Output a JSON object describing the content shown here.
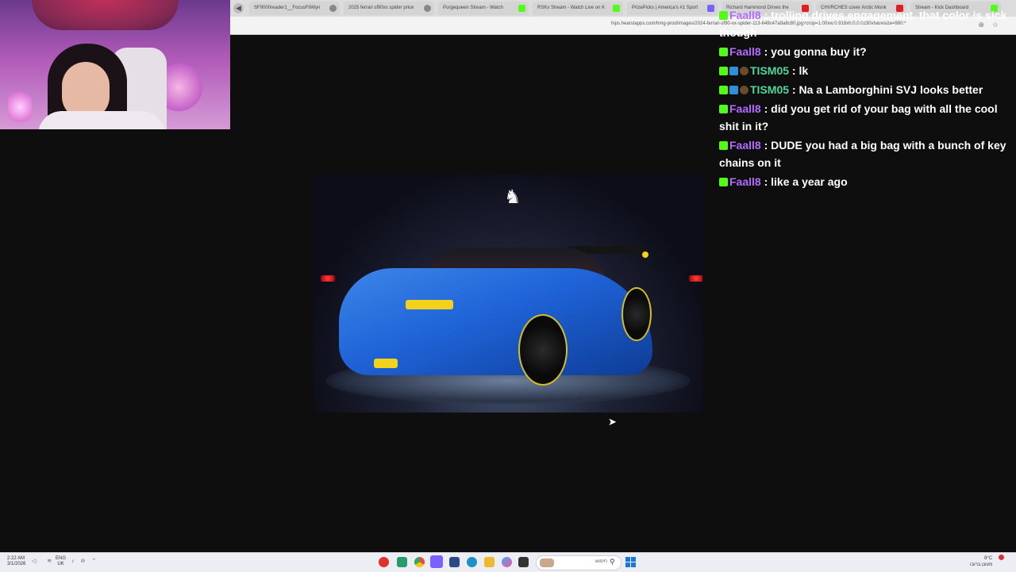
{
  "browser": {
    "tabs": [
      {
        "title": "SF9000reader1__FocusFitWyn",
        "favicon": "other"
      },
      {
        "title": "2025 ferrari sf90xx spider price",
        "favicon": "other"
      },
      {
        "title": "Purgequeen Stream - Watch",
        "favicon": "kick"
      },
      {
        "title": "RSKx Stream - Watch Live on K",
        "favicon": "kick"
      },
      {
        "title": "PrizePicks | America's #1 Sport",
        "favicon": "pp"
      },
      {
        "title": "Richard Hammond Drives the",
        "favicon": "yt"
      },
      {
        "title": "CHVRCHES cover Arctic Monk",
        "favicon": "yt"
      },
      {
        "title": "Stream - Kick Dashboard",
        "favicon": "kick"
      }
    ],
    "url": "hips.hearstapps.com/hmg-prod/images/2024-ferrari-sf90-xx-spider-113-649c47a9a8c80.jpg?crop=1.00xw:0.918xh;0,0.0230xh&resize=980:*"
  },
  "chat": {
    "messages": [
      {
        "user": "Faall8",
        "text": "trolling drives engagement. that color is sick though",
        "color": "#b36bff",
        "badges": [
          "kick-badge"
        ]
      },
      {
        "user": "Faall8",
        "text": "you gonna buy it?",
        "color": "#b36bff",
        "badges": [
          "kick-badge"
        ]
      },
      {
        "user": "TISM05",
        "text": "lk",
        "color": "#4fd69c",
        "badges": [
          "kick-badge",
          "verified-badge",
          "ball-badge"
        ]
      },
      {
        "user": "TISM05",
        "text": "Na a Lamborghini SVJ looks better",
        "color": "#4fd69c",
        "badges": [
          "kick-badge",
          "verified-badge",
          "ball-badge"
        ]
      },
      {
        "user": "Faall8",
        "text": "did you get rid of your bag with all the cool shit in it?",
        "color": "#b36bff",
        "badges": [
          "kick-badge"
        ]
      },
      {
        "user": "Faall8",
        "text": "DUDE you had a big bag with a bunch of key chains on it",
        "color": "#b36bff",
        "badges": [
          "kick-badge"
        ]
      },
      {
        "user": "Faall8",
        "text": "like a year ago",
        "color": "#b36bff",
        "badges": [
          "kick-badge"
        ]
      }
    ]
  },
  "taskbar": {
    "time": "2:22 AM",
    "date": "3/1/2026",
    "lang_top": "ENG",
    "lang_bottom": "UK",
    "search_text": "חיפוש",
    "weather_temp": "8°C",
    "weather_desc": "מעונן ברובו"
  },
  "colors": {
    "accent_kick": "#53fc18",
    "background": "#0e0e0e"
  }
}
